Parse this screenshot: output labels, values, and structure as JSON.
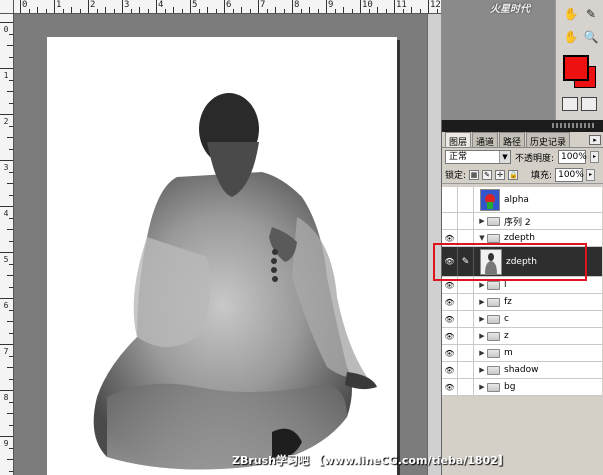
{
  "ruler": {
    "top_labels": [
      "0",
      "1",
      "2",
      "3",
      "4",
      "5",
      "6",
      "7",
      "8",
      "9",
      "10",
      "11",
      "12"
    ],
    "left_labels": [
      "0",
      "1",
      "2",
      "3",
      "4",
      "5",
      "6",
      "7",
      "8",
      "9"
    ]
  },
  "toolstrip": {
    "hand_glyph": "✋",
    "eyedropper_glyph": "✎",
    "foreground_color": "#ee1111",
    "background_color": "#ee1111"
  },
  "panel": {
    "tabs": [
      "图层",
      "通道",
      "路径",
      "历史记录"
    ],
    "blend_mode": "正常",
    "opacity_label": "不透明度:",
    "opacity_value": "100%",
    "lock_label": "锁定:",
    "fill_label": "填充:",
    "fill_value": "100%",
    "layers": [
      {
        "name": "alpha",
        "visible": false,
        "type": "layer"
      },
      {
        "name": "序列 2",
        "visible": false,
        "type": "group"
      },
      {
        "name": "zdepth",
        "visible": true,
        "type": "group",
        "expanded": true
      },
      {
        "name": "zdepth",
        "visible": true,
        "type": "layer",
        "selected": true
      },
      {
        "name": "l",
        "visible": true,
        "type": "group"
      },
      {
        "name": "fz",
        "visible": true,
        "type": "group"
      },
      {
        "name": "c",
        "visible": true,
        "type": "group"
      },
      {
        "name": "z",
        "visible": true,
        "type": "group"
      },
      {
        "name": "m",
        "visible": true,
        "type": "group"
      },
      {
        "name": "shadow",
        "visible": true,
        "type": "group"
      },
      {
        "name": "bg",
        "visible": true,
        "type": "group"
      }
    ]
  },
  "watermark": {
    "text": "ZBrush学习吧 【www.lineCG.com/tieba/1802】",
    "top_logo": "火星时代"
  },
  "icons": {
    "eye": "👁",
    "brush": "✎",
    "triangle_right": "▶",
    "triangle_down": "▼"
  }
}
